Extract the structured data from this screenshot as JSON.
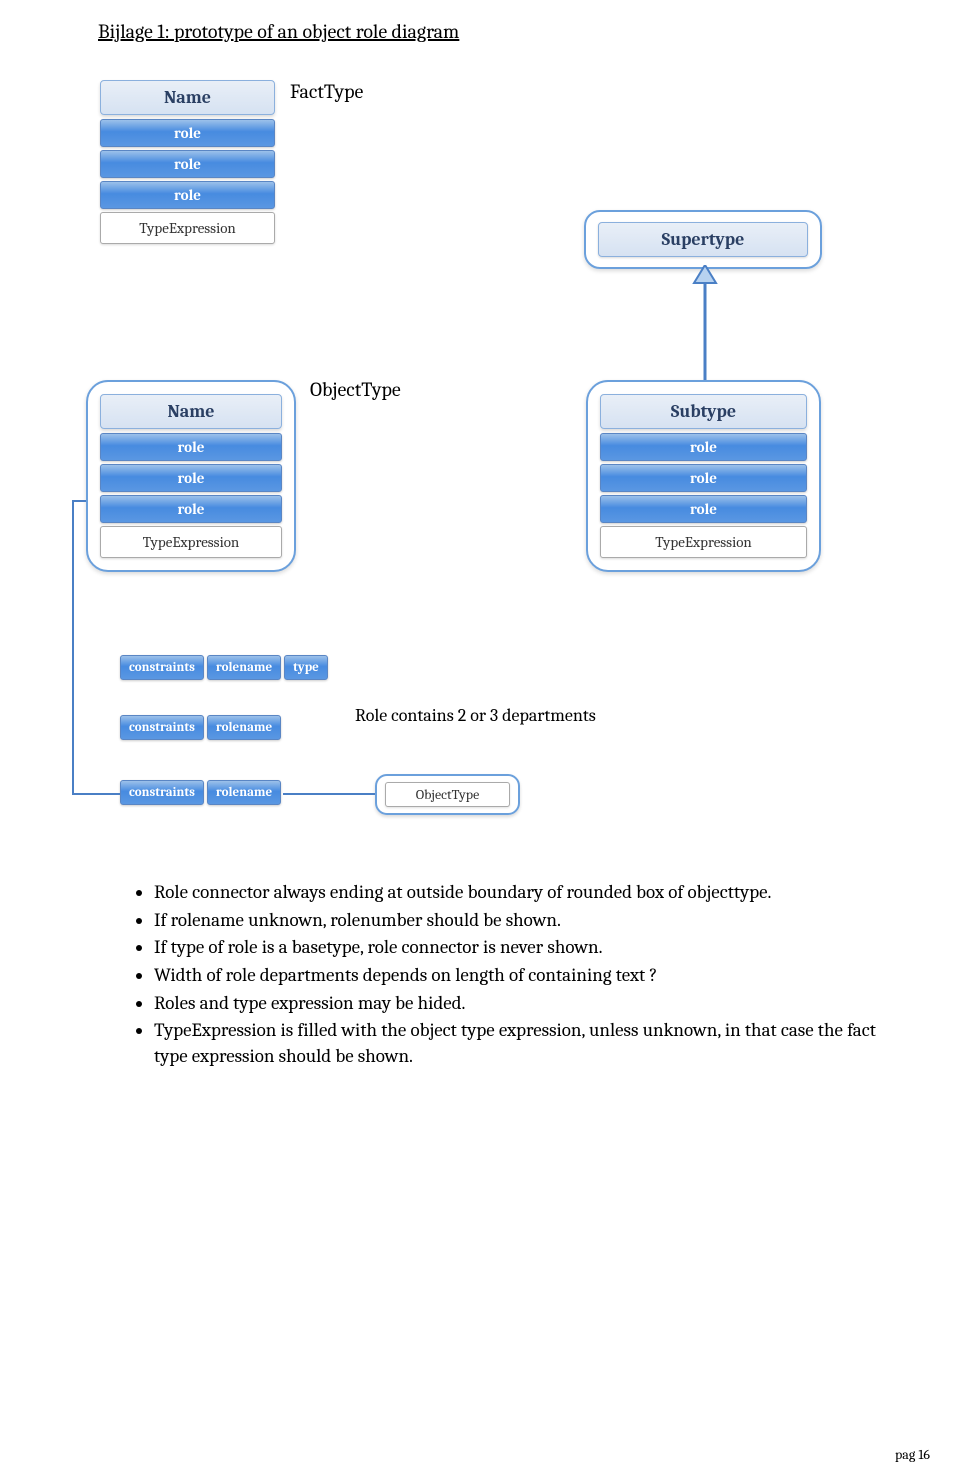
{
  "title": "Bijlage 1: prototype of an object role diagram",
  "labels": {
    "facttype": "FactType",
    "objecttype": "ObjectType",
    "role_departments": "Role contains 2 or 3 departments"
  },
  "facttype_box": {
    "header": "Name",
    "rows": [
      "role",
      "role",
      "role"
    ],
    "footer": "TypeExpression"
  },
  "supertype_box": {
    "header": "Supertype"
  },
  "objecttype_box": {
    "header": "Name",
    "rows": [
      "role",
      "role",
      "role"
    ],
    "footer": "TypeExpression"
  },
  "subtype_box": {
    "header": "Subtype",
    "rows": [
      "role",
      "role",
      "role"
    ],
    "footer": "TypeExpression"
  },
  "constraints": {
    "row1": [
      "constraints",
      "rolename",
      "type"
    ],
    "row2": [
      "constraints",
      "rolename"
    ],
    "row3": [
      "constraints",
      "rolename"
    ]
  },
  "small_objecttype": "ObjectType",
  "bullets": [
    "Role connector always ending at outside boundary of rounded box of objecttype.",
    "If rolename unknown, rolenumber should be shown.",
    "If type of role is a basetype, role connector is never shown.",
    "Width of role departments depends on length of containing text ?",
    "Roles and type expression may be hided.",
    "TypeExpression is filled with the object type expression, unless unknown, in that case the fact type expression should be shown."
  ],
  "page_number": "pag 16"
}
